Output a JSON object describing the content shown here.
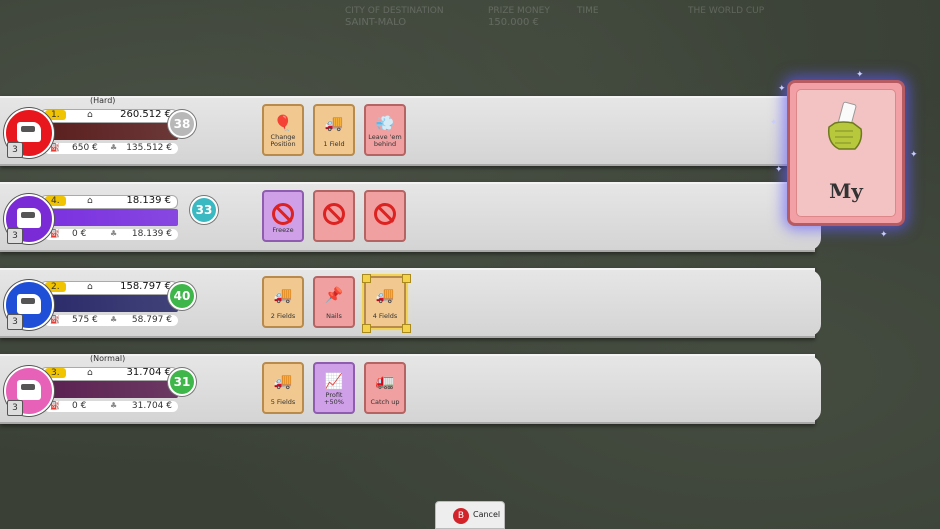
{
  "players": [
    {
      "difficulty": "(Hard)",
      "rank": "1.",
      "money": "260.512 €",
      "score": "38",
      "card_count": "3",
      "sub_left": "650 €",
      "sub_right": "135.512 €",
      "color": "#e8161d",
      "score_color": "#b8b8b8",
      "bar_color": "#5a1e1e",
      "cards": [
        {
          "label": "Change Position",
          "style": "orange",
          "icon": "balloon-icon",
          "glyph": "🎈"
        },
        {
          "label": "1 Field",
          "style": "orange",
          "icon": "truck-road-icon",
          "glyph": "🚚"
        },
        {
          "label": "Leave 'em behind",
          "style": "pink",
          "icon": "dust-trail-icon",
          "glyph": "💨"
        }
      ]
    },
    {
      "difficulty": "",
      "rank": "4.",
      "money": "18.139 €",
      "score": "33",
      "card_count": "3",
      "sub_left": "0 €",
      "sub_right": "18.139 €",
      "color": "#7a2bd6",
      "score_color": "#3bb9c2",
      "bar_color": "#7a30e0",
      "cards": [
        {
          "label": "Freeze",
          "style": "purple",
          "icon": "blocked-icon",
          "glyph": ""
        },
        {
          "label": "",
          "style": "pink",
          "icon": "blocked-icon",
          "glyph": ""
        },
        {
          "label": "",
          "style": "pink",
          "icon": "blocked-icon",
          "glyph": ""
        }
      ]
    },
    {
      "difficulty": "",
      "rank": "2.",
      "money": "158.797 €",
      "score": "40",
      "card_count": "3",
      "sub_left": "575 €",
      "sub_right": "58.797 €",
      "color": "#1e4fd6",
      "score_color": "#3fb64a",
      "bar_color": "#2a2a6a",
      "cards": [
        {
          "label": "2 Fields",
          "style": "orange",
          "icon": "truck-road-icon",
          "glyph": "🚚"
        },
        {
          "label": "Nails",
          "style": "pink",
          "icon": "nails-icon",
          "glyph": "📌"
        },
        {
          "label": "4 Fields",
          "style": "orange",
          "icon": "truck-road-icon",
          "glyph": "🚚"
        }
      ]
    },
    {
      "difficulty": "(Normal)",
      "rank": "3.",
      "money": "31.704 €",
      "score": "31",
      "card_count": "3",
      "sub_left": "0 €",
      "sub_right": "31.704 €",
      "color": "#e861b8",
      "score_color": "#3fb64a",
      "bar_color": "#5a2050",
      "cards": [
        {
          "label": "5 Fields",
          "style": "orange",
          "icon": "truck-road-icon",
          "glyph": "🚚"
        },
        {
          "label": "Profit +50%",
          "style": "purple",
          "icon": "profit-icon",
          "glyph": "📈"
        },
        {
          "label": "Catch up",
          "style": "pink",
          "icon": "catch-up-icon",
          "glyph": "🚛"
        }
      ]
    }
  ],
  "big_card": {
    "title": "My",
    "icon": "hand-holding-card-icon"
  },
  "cancel": {
    "button_glyph": "B",
    "label": "Cancel"
  },
  "topbar": {
    "col1": "CITY OF DESTINATION",
    "col1_value": "SAINT-MALO",
    "col2": "PRIZE MONEY",
    "col2_value": "150.000 €",
    "col3": "TIME",
    "col4": "THE WORLD CUP"
  }
}
